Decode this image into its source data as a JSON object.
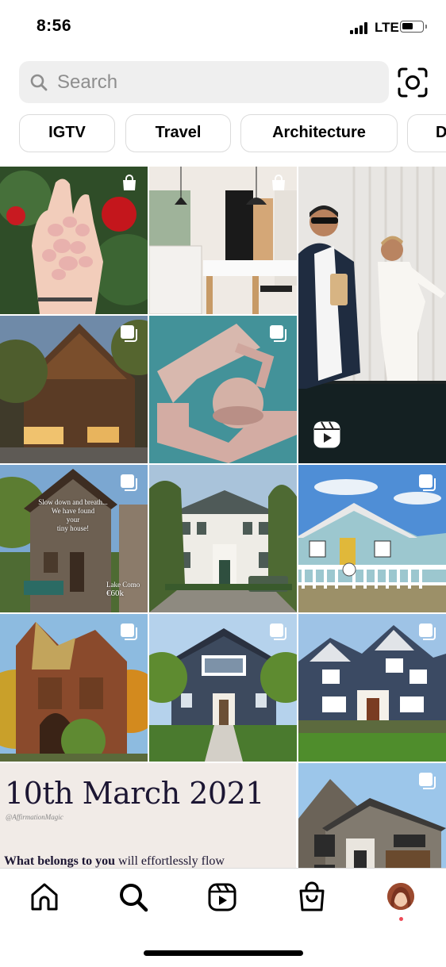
{
  "status_bar": {
    "time": "8:56",
    "network": "LTE"
  },
  "search": {
    "placeholder": "Search",
    "icon": "search-icon"
  },
  "scan_icon": "scan-icon",
  "chips": [
    {
      "label": "IGTV"
    },
    {
      "label": "Travel"
    },
    {
      "label": "Architecture"
    },
    {
      "label": "D"
    }
  ],
  "grid": {
    "tiles": [
      {
        "subject": "rose quartz stones in hand",
        "badge": "shopping-bag-icon"
      },
      {
        "subject": "modern kitchen",
        "badge": "shopping-bag-icon"
      },
      {
        "subject": "couple mirror selfie reel",
        "badge": "reels-icon"
      },
      {
        "subject": "wooden chalet house",
        "badge": "carousel-icon"
      },
      {
        "subject": "pink sofa in pool",
        "badge": "carousel-icon"
      },
      {
        "subject": "stone house Lake Como",
        "badge": "carousel-icon",
        "overlay_caption": "Slow down and breath...\nWe have found\nyour\ntiny house!",
        "overlay_price": "Lake Como\n€60k"
      },
      {
        "subject": "white colonial mansion",
        "badge": "none"
      },
      {
        "subject": "light blue cottage",
        "badge": "carousel-icon"
      },
      {
        "subject": "victorian house autumn",
        "badge": "carousel-icon"
      },
      {
        "subject": "dark blue modern farmhouse",
        "badge": "carousel-icon"
      },
      {
        "subject": "navy blue craftsman house",
        "badge": "carousel-icon"
      },
      {
        "subject": "grey stone modern house",
        "badge": "carousel-icon"
      }
    ],
    "text_post": {
      "title": "10th March 2021",
      "handle": "@AffirmationMagic",
      "body_bold": "What belongs to you",
      "body_rest": " will effortlessly flow"
    }
  },
  "tabbar": {
    "tabs": [
      "home-icon",
      "search-icon",
      "reels-icon",
      "shop-icon",
      "profile-avatar"
    ]
  },
  "colors": {
    "search_bg": "#efefef",
    "chip_border": "#dbdbdb",
    "notification_dot": "#ed4956"
  }
}
